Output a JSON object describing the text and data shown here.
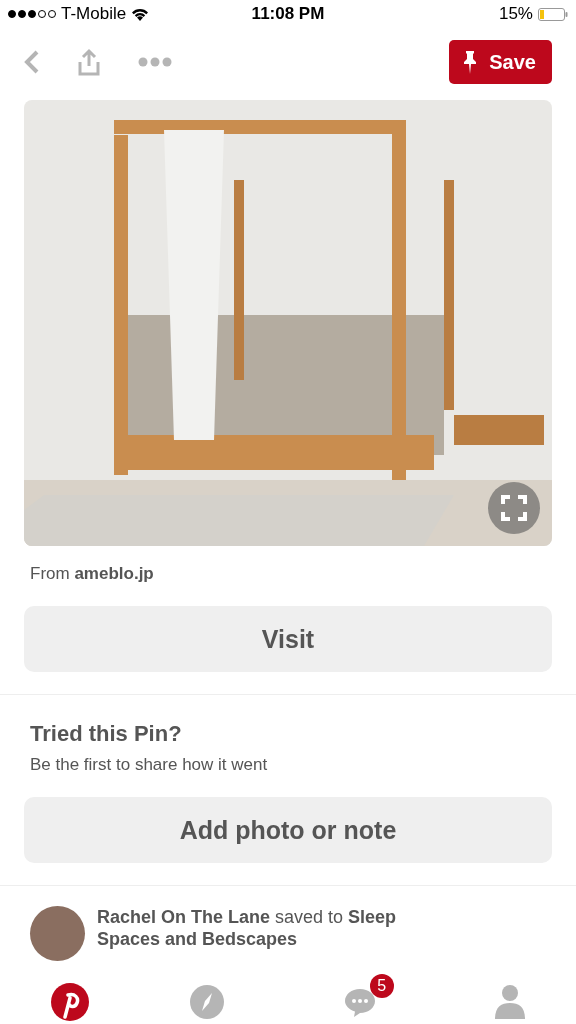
{
  "status_bar": {
    "carrier": "T-Mobile",
    "time": "11:08 PM",
    "battery": "15%"
  },
  "toolbar": {
    "save_label": "Save"
  },
  "pin": {
    "source": "From **ameblo.jp**",
    "visit_label": "Visit"
  },
  "tried": {
    "title": "Tried this Pin?",
    "subtitle": "Be the first to share how it went",
    "button": "Add photo or note"
  },
  "saved": {
    "text": "**Rachel On The Lane** saved to **Sleep Spaces and Bedscapes**"
  },
  "tabs": [
    {
      "kind": "home",
      "selected": true
    },
    {
      "kind": "explore",
      "selected": false
    },
    {
      "kind": "messages",
      "selected": false,
      "badge": "5"
    },
    {
      "kind": "profile",
      "selected": false
    }
  ]
}
